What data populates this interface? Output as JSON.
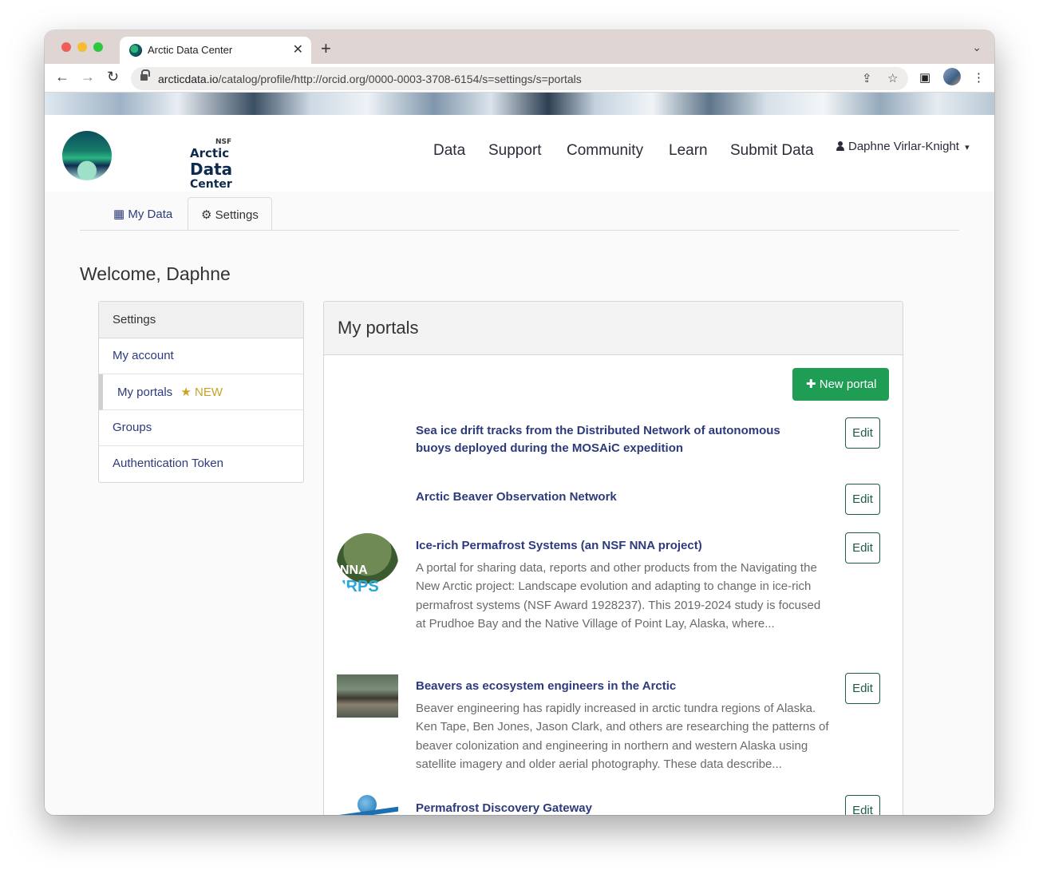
{
  "browser": {
    "tab_title": "Arctic Data Center",
    "tab_close": "✕",
    "new_tab": "+",
    "tab_menu": "⌄",
    "url_host": "arcticdata.io",
    "url_path": "/catalog/profile/http://orcid.org/0000-0003-3708-6154/s=settings/s=portals",
    "back": "←",
    "forward": "→",
    "reload": "↻",
    "share": "⇪",
    "star": "☆",
    "sidepanel": "▣",
    "menu": "⋮"
  },
  "site": {
    "logo_nsf": "NSF",
    "logo_line1": "Arctic",
    "logo_line2": "Data",
    "logo_line3": "Center",
    "nav": [
      "Data",
      "Support",
      "Community",
      "Learn",
      "Submit Data"
    ],
    "user_name": "Daphne Virlar-Knight",
    "user_caret": "▾"
  },
  "profile_tabs": [
    {
      "icon": "▦",
      "label": "My Data"
    },
    {
      "icon": "⚙",
      "label": "Settings"
    }
  ],
  "welcome": "Welcome, Daphne",
  "settings_menu": {
    "heading": "Settings",
    "items": [
      "My account",
      "My portals",
      "Groups",
      "Authentication Token"
    ],
    "new_star": "★",
    "new_label": "NEW"
  },
  "portals_panel": {
    "heading": "My portals",
    "new_button": "New portal",
    "new_button_icon": "✚",
    "edit_label": "Edit",
    "portals": [
      {
        "title": "Sea ice drift tracks from the Distributed Network of autonomous buoys deployed during the MOSAiC expedition",
        "description": ""
      },
      {
        "title": "Arctic Beaver Observation Network",
        "description": ""
      },
      {
        "title": "Ice-rich Permafrost Systems (an NSF NNA project)",
        "description": "A portal for sharing data, reports and other products from the Navigating the New Arctic project: Landscape evolution and adapting to change in ice-rich permafrost systems (NSF Award 1928237). This 2019-2024 study is focused at Prudhoe Bay and the Native Village of Point Lay, Alaska, where...",
        "thumb_text1": "NNA",
        "thumb_text2": "IRPS"
      },
      {
        "title": "Beavers as ecosystem engineers in the Arctic",
        "description": "Beaver engineering has rapidly increased in arctic tundra regions of Alaska. Ken Tape, Ben Jones, Jason Clark, and others are researching the patterns of beaver colonization and engineering in northern and western Alaska using satellite imagery and older aerial photography. These data describe..."
      },
      {
        "title": "Permafrost Discovery Gateway",
        "description": ""
      }
    ]
  },
  "colors": {
    "link": "#2d3b7c",
    "primary_button": "#1f9d55",
    "edit_border": "#1c5b4a",
    "new_badge": "#c9a227"
  }
}
